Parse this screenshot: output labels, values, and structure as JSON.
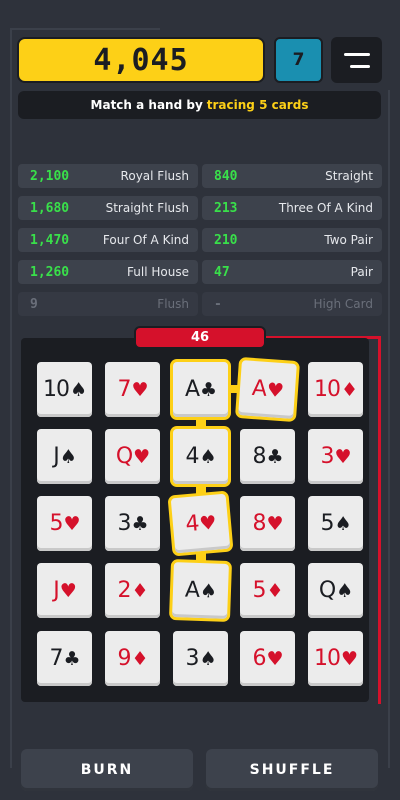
{
  "header": {
    "score": "4,045",
    "level": "7",
    "menu_icon": "hamburger-menu-icon"
  },
  "hint": {
    "prefix": "Match a hand by",
    "highlight": "tracing 5 cards"
  },
  "hands": {
    "left": [
      {
        "points": "2,100",
        "name": "Royal Flush"
      },
      {
        "points": "1,680",
        "name": "Straight Flush"
      },
      {
        "points": "1,470",
        "name": "Four Of A Kind"
      },
      {
        "points": "1,260",
        "name": "Full House"
      },
      {
        "points": "9",
        "name": "Flush"
      }
    ],
    "right": [
      {
        "points": "840",
        "name": "Straight"
      },
      {
        "points": "213",
        "name": "Three Of A Kind"
      },
      {
        "points": "210",
        "name": "Two Pair"
      },
      {
        "points": "47",
        "name": "Pair"
      },
      {
        "points": "-",
        "name": "High Card"
      }
    ]
  },
  "timer": "46",
  "cards": [
    [
      {
        "rank": "10",
        "suit": "♠",
        "color": "black"
      },
      {
        "rank": "7",
        "suit": "♥",
        "color": "red"
      },
      {
        "rank": "A",
        "suit": "♣",
        "color": "black",
        "selected": true
      },
      {
        "rank": "A",
        "suit": "♥",
        "color": "red",
        "selected": true
      },
      {
        "rank": "10",
        "suit": "♦",
        "color": "red"
      }
    ],
    [
      {
        "rank": "J",
        "suit": "♠",
        "color": "black"
      },
      {
        "rank": "Q",
        "suit": "♥",
        "color": "red"
      },
      {
        "rank": "4",
        "suit": "♠",
        "color": "black",
        "selected": true
      },
      {
        "rank": "8",
        "suit": "♣",
        "color": "black"
      },
      {
        "rank": "3",
        "suit": "♥",
        "color": "red"
      }
    ],
    [
      {
        "rank": "5",
        "suit": "♥",
        "color": "red"
      },
      {
        "rank": "3",
        "suit": "♣",
        "color": "black"
      },
      {
        "rank": "4",
        "suit": "♥",
        "color": "red",
        "selected": true
      },
      {
        "rank": "8",
        "suit": "♥",
        "color": "red"
      },
      {
        "rank": "5",
        "suit": "♠",
        "color": "black"
      }
    ],
    [
      {
        "rank": "J",
        "suit": "♥",
        "color": "red"
      },
      {
        "rank": "2",
        "suit": "♦",
        "color": "red"
      },
      {
        "rank": "A",
        "suit": "♠",
        "color": "black",
        "selected": true
      },
      {
        "rank": "5",
        "suit": "♦",
        "color": "red"
      },
      {
        "rank": "Q",
        "suit": "♠",
        "color": "black"
      }
    ],
    [
      {
        "rank": "7",
        "suit": "♣",
        "color": "black"
      },
      {
        "rank": "9",
        "suit": "♦",
        "color": "red"
      },
      {
        "rank": "3",
        "suit": "♠",
        "color": "black"
      },
      {
        "rank": "6",
        "suit": "♥",
        "color": "red"
      },
      {
        "rank": "10",
        "suit": "♥",
        "color": "red"
      }
    ]
  ],
  "buttons": {
    "burn": "BURN",
    "shuffle": "SHUFFLE"
  },
  "colors": {
    "accent": "#fdd017",
    "timer": "#d5112b",
    "points": "#39e04a",
    "background": "#2e323b"
  }
}
